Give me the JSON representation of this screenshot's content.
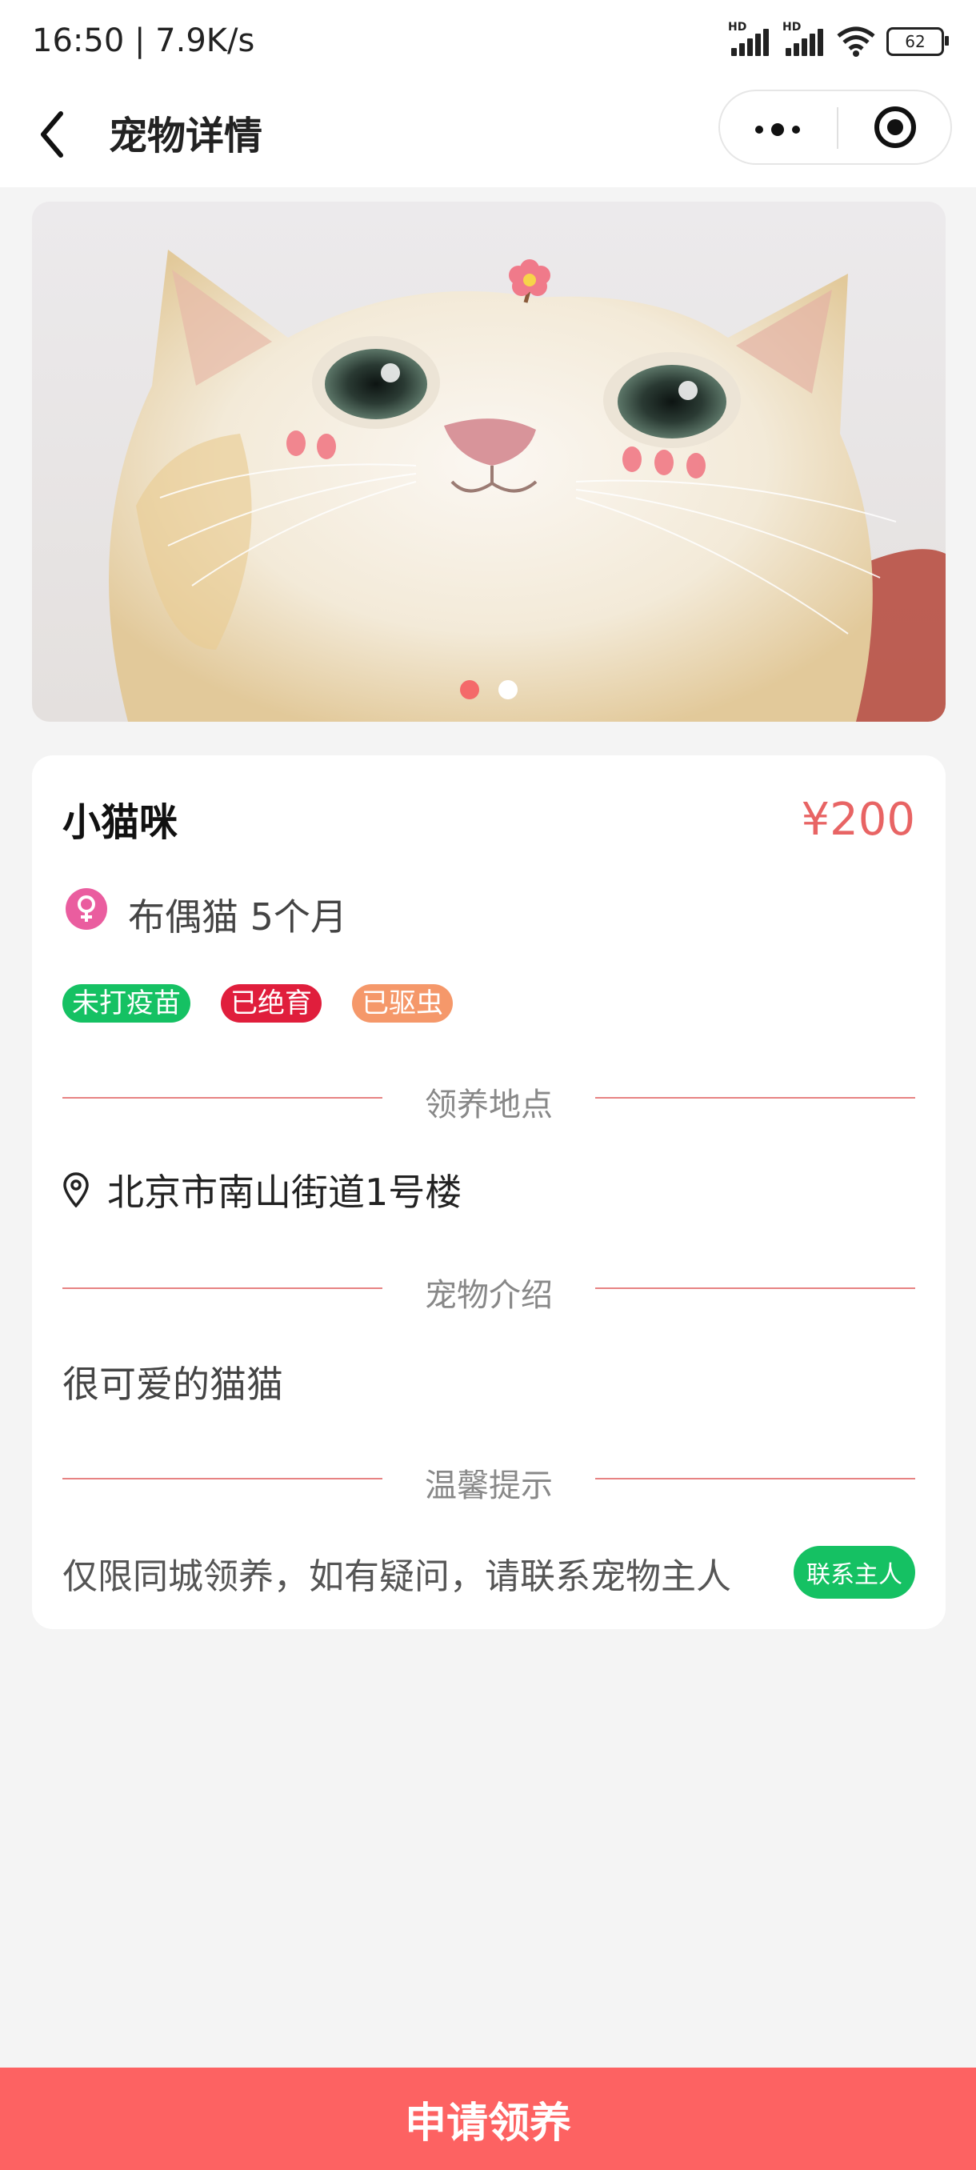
{
  "status_bar": {
    "time": "16:50 | 7.9K/s",
    "battery": "62",
    "signal_label": "HD"
  },
  "navbar": {
    "title": "宠物详情",
    "icons": [
      "back-arrow-icon",
      "more-dots-icon",
      "record-circle-icon"
    ]
  },
  "banner": {
    "image": "cat-photo",
    "slide_count": 2,
    "active_slide": 1
  },
  "pet": {
    "name": "小猫咪",
    "price": "¥200",
    "gender_icon": "female-icon",
    "meta": "布偶猫  5个月",
    "tags": [
      {
        "label": "未打疫苗",
        "color": "#15c163"
      },
      {
        "label": "已绝育",
        "color": "#e01e3c"
      },
      {
        "label": "已驱虫",
        "color": "#f5986a"
      }
    ]
  },
  "sections": {
    "location_title": "领养地点",
    "address": "北京市南山街道1号楼",
    "intro_title": "宠物介绍",
    "intro": "很可爱的猫猫",
    "tips_title": "温馨提示",
    "tip": "仅限同城领养，如有疑问，请联系宠物主人",
    "contact_label": "联系主人"
  },
  "footer": {
    "apply_label": "申请领养"
  },
  "colors": {
    "accent": "#fd6262",
    "price": "#e86464",
    "divider": "#e78383",
    "green": "#15c163"
  }
}
